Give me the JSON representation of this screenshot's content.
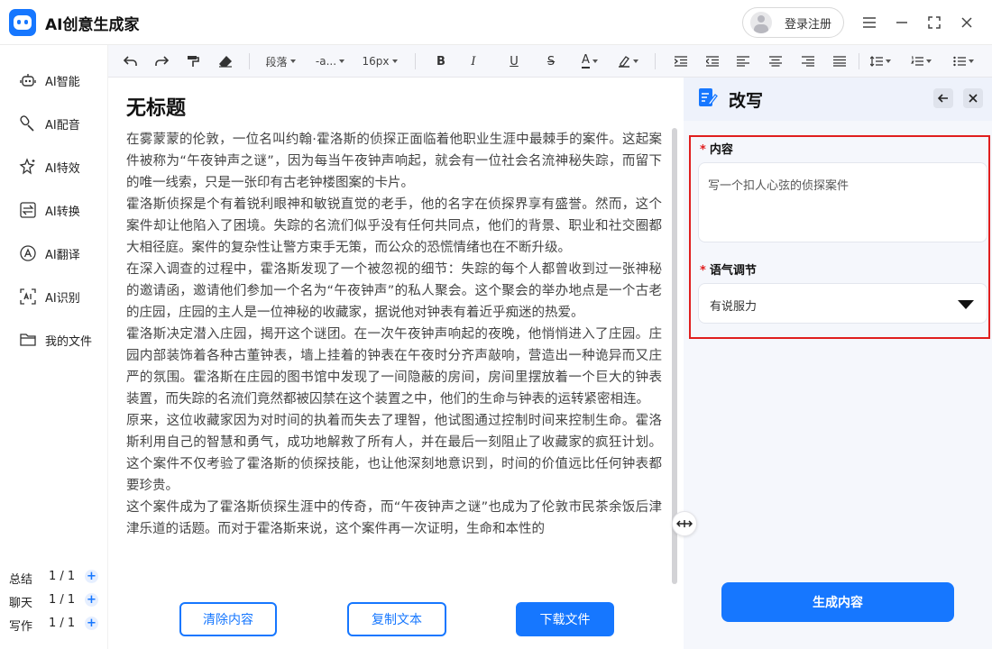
{
  "app": {
    "title": "AI创意生成家",
    "login_label": "登录注册",
    "brand_color": "#1677ff"
  },
  "sidebar": {
    "items": [
      {
        "label": "AI智能",
        "icon": "robot-icon"
      },
      {
        "label": "AI配音",
        "icon": "microphone-icon"
      },
      {
        "label": "AI特效",
        "icon": "sparkle-star-icon"
      },
      {
        "label": "AI转换",
        "icon": "convert-icon"
      },
      {
        "label": "AI翻译",
        "icon": "translate-icon"
      },
      {
        "label": "AI识别",
        "icon": "scan-ai-icon"
      },
      {
        "label": "我的文件",
        "icon": "folder-icon"
      }
    ],
    "stats": [
      {
        "name": "总结",
        "count": "1 / 1"
      },
      {
        "name": "聊天",
        "count": "1 / 1"
      },
      {
        "name": "写作",
        "count": "1 / 1"
      }
    ]
  },
  "toolbar": {
    "paragraph": "段落",
    "font": "-a...",
    "font_size": "16px"
  },
  "document": {
    "title": "无标题",
    "paragraphs": [
      "在雾蒙蒙的伦敦，一位名叫约翰·霍洛斯的侦探正面临着他职业生涯中最棘手的案件。这起案件被称为“午夜钟声之谜”，因为每当午夜钟声响起，就会有一位社会名流神秘失踪，而留下的唯一线索，只是一张印有古老钟楼图案的卡片。",
      "霍洛斯侦探是个有着锐利眼神和敏锐直觉的老手，他的名字在侦探界享有盛誉。然而，这个案件却让他陷入了困境。失踪的名流们似乎没有任何共同点，他们的背景、职业和社交圈都大相径庭。案件的复杂性让警方束手无策，而公众的恐慌情绪也在不断升级。",
      "在深入调查的过程中，霍洛斯发现了一个被忽视的细节：失踪的每个人都曾收到过一张神秘的邀请函，邀请他们参加一个名为“午夜钟声”的私人聚会。这个聚会的举办地点是一个古老的庄园，庄园的主人是一位神秘的收藏家，据说他对钟表有着近乎痴迷的热爱。",
      "霍洛斯决定潜入庄园，揭开这个谜团。在一次午夜钟声响起的夜晚，他悄悄进入了庄园。庄园内部装饰着各种古董钟表，墙上挂着的钟表在午夜时分齐声敲响，营造出一种诡异而又庄严的氛围。霍洛斯在庄园的图书馆中发现了一间隐蔽的房间，房间里摆放着一个巨大的钟表装置，而失踪的名流们竟然都被囚禁在这个装置之中，他们的生命与钟表的运转紧密相连。",
      "原来，这位收藏家因为对时间的执着而失去了理智，他试图通过控制时间来控制生命。霍洛斯利用自己的智慧和勇气，成功地解救了所有人，并在最后一刻阻止了收藏家的疯狂计划。这个案件不仅考验了霍洛斯的侦探技能，也让他深刻地意识到，时间的价值远比任何钟表都要珍贵。",
      "这个案件成为了霍洛斯侦探生涯中的传奇，而“午夜钟声之谜”也成为了伦敦市民茶余饭后津津乐道的话题。而对于霍洛斯来说，这个案件再一次证明，生命和本性的"
    ]
  },
  "actions": {
    "clear": "清除内容",
    "copy": "复制文本",
    "download": "下载文件"
  },
  "panel": {
    "title": "改写",
    "content_label": "内容",
    "content_value": "写一个扣人心弦的侦探案件",
    "tone_label": "语气调节",
    "tone_value": "有说服力",
    "generate": "生成内容",
    "required_mark": "*"
  }
}
